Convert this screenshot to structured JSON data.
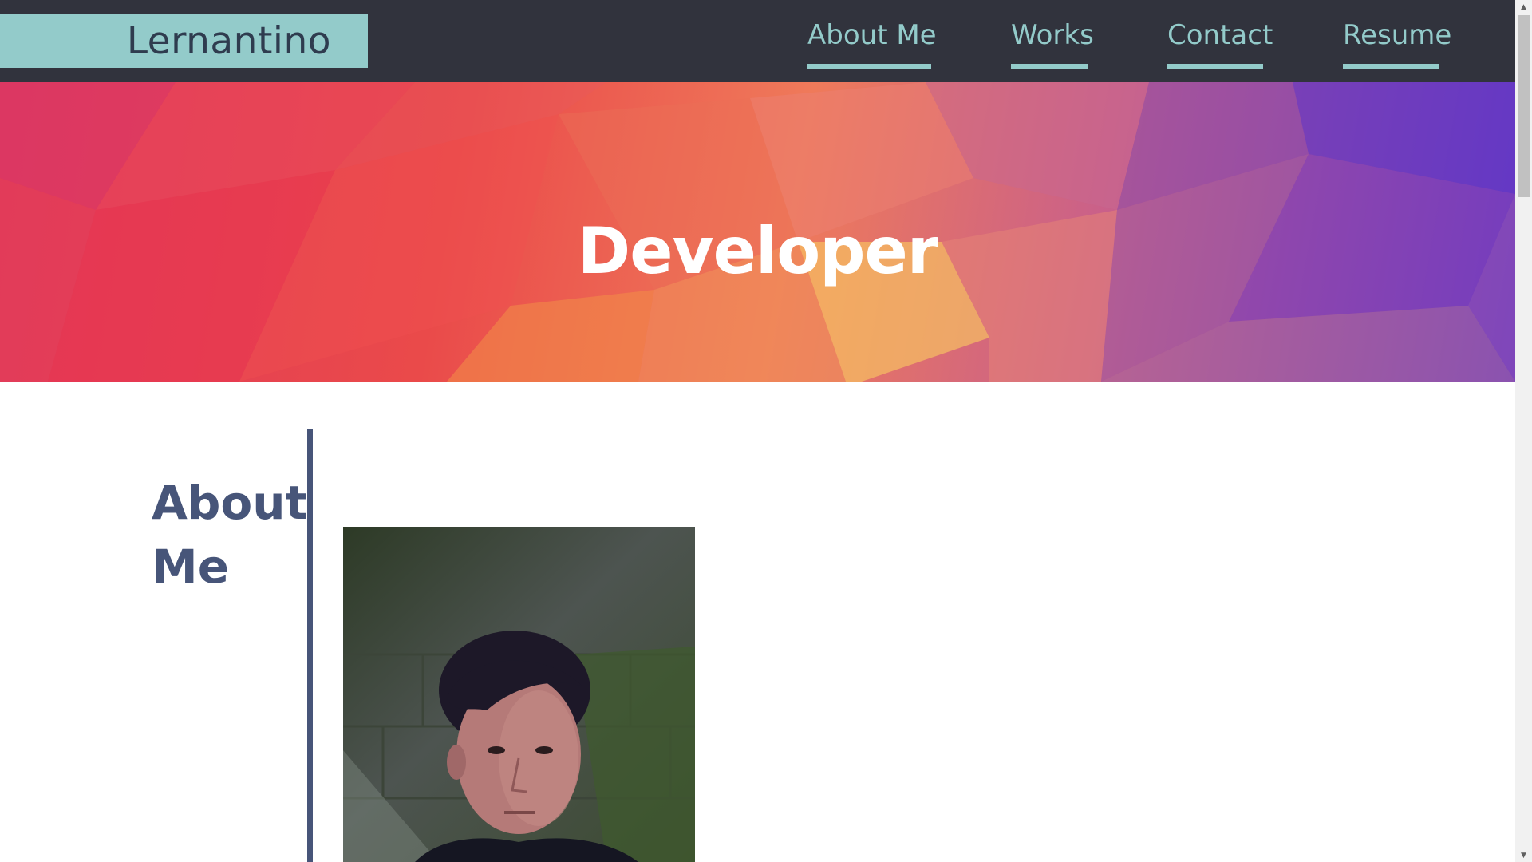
{
  "header": {
    "brand": "Lernantino",
    "nav": [
      {
        "label": "About Me"
      },
      {
        "label": "Works"
      },
      {
        "label": "Contact"
      },
      {
        "label": "Resume"
      }
    ]
  },
  "hero": {
    "title": "Developer"
  },
  "about": {
    "heading": "About Me"
  },
  "colors": {
    "nav_background": "#31333d",
    "accent": "#93cbca",
    "heading": "#475579"
  }
}
